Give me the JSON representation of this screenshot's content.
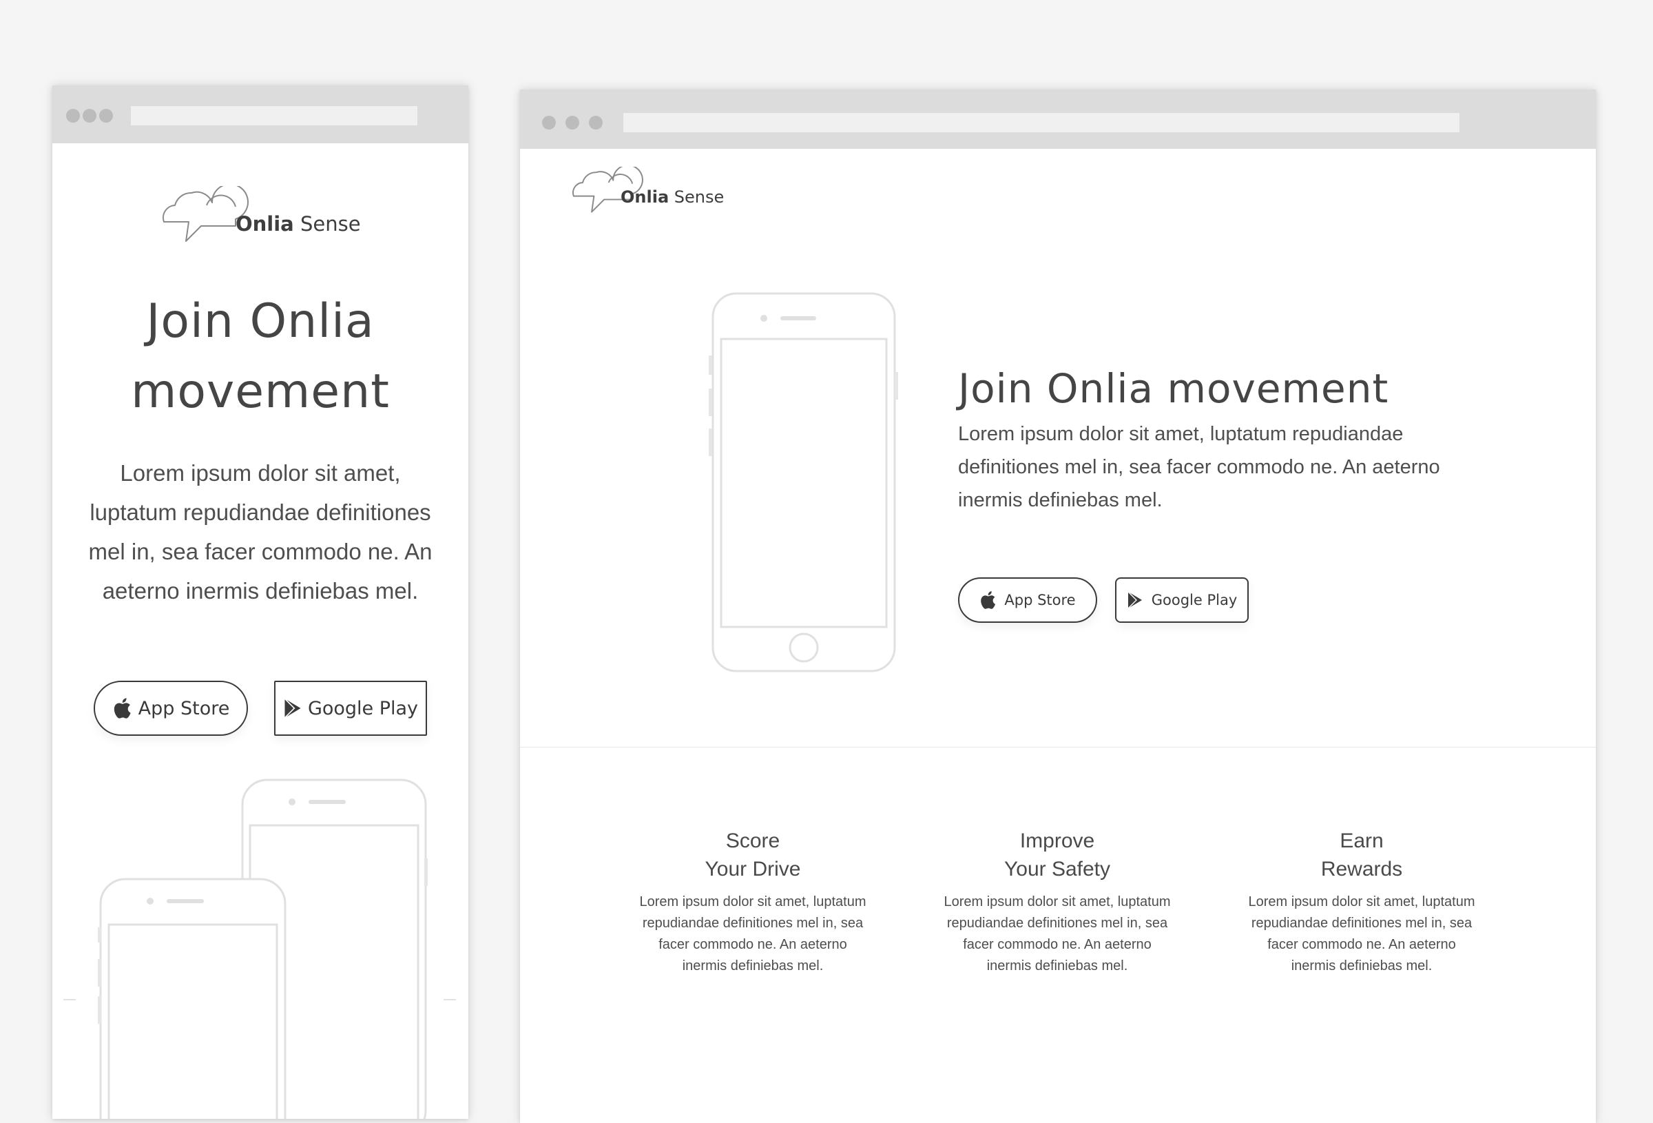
{
  "brand": {
    "name_bold": "Onlia",
    "name_light": "Sense"
  },
  "mobile": {
    "headline": "Join Onlia movement",
    "body": "Lorem ipsum dolor sit amet, luptatum repudiandae definitiones mel in, sea facer commodo ne. An aeterno inermis definiebas mel.",
    "app_store_label": "App Store",
    "google_play_label": "Google Play"
  },
  "desktop": {
    "headline": "Join Onlia movement",
    "body": "Lorem ipsum dolor sit amet, luptatum repudiandae definitiones mel in, sea facer commodo ne. An aeterno inermis definiebas mel.",
    "app_store_label": "App Store",
    "google_play_label": "Google Play",
    "features": [
      {
        "title_line1": "Score",
        "title_line2": "Your Drive",
        "text": "Lorem ipsum dolor sit amet, luptatum repudiandae definitiones mel in, sea facer commodo ne. An aeterno inermis definiebas mel."
      },
      {
        "title_line1": "Improve",
        "title_line2": "Your Safety",
        "text": "Lorem ipsum dolor sit amet, luptatum repudiandae definitiones mel in, sea facer commodo ne. An aeterno inermis definiebas mel."
      },
      {
        "title_line1": "Earn",
        "title_line2": "Rewards",
        "text": "Lorem ipsum dolor sit amet, luptatum repudiandae definitiones mel in, sea facer commodo ne. An aeterno inermis definiebas mel."
      }
    ]
  },
  "icons": {
    "logo": "speech-bubbles-icon",
    "app_store": "apple-icon",
    "google_play": "play-triangle-icon",
    "window_controls": "window-dots-icon"
  },
  "colors": {
    "page_background": "#f5f5f5",
    "window_chrome": "#dcdcdc",
    "text": "#4a4a4a",
    "button_border": "#3a3a3a",
    "phone_outline": "#e2e2e2"
  }
}
